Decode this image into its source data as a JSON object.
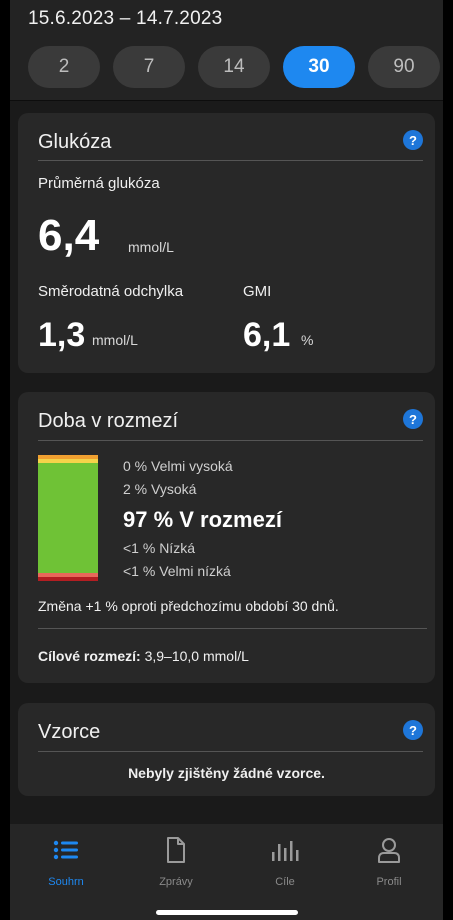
{
  "header": {
    "date_range": "15.6.2023 – 14.7.2023",
    "chips": [
      "2",
      "7",
      "14",
      "30",
      "90"
    ],
    "selected_chip": "30"
  },
  "glucose": {
    "title": "Glukóza",
    "help": "?",
    "avg_label": "Průměrná glukóza",
    "avg_value": "6,4",
    "avg_unit": "mmol/L",
    "sd_label": "Směrodatná odchylka",
    "sd_value": "1,3",
    "sd_unit": "mmol/L",
    "gmi_label": "GMI",
    "gmi_value": "6,1",
    "gmi_unit": "%"
  },
  "time_in_range": {
    "title": "Doba v rozmezí",
    "help": "?",
    "very_high": "0 % Velmi vysoká",
    "high": "2 % Vysoká",
    "in_range": "97 % V rozmezí",
    "low": "<1 % Nízká",
    "very_low": "<1 % Velmi nízká",
    "change_text": "Změna +1 % oproti předchozímu období 30 dnů.",
    "target_label": "Cílové rozmezí:",
    "target_value": "3,9–10,0 mmol/L",
    "segments": {
      "very_high": 0,
      "high": 2,
      "in_range": 97,
      "low": 0.5,
      "very_low": 0.5
    },
    "colors": {
      "very_high": "#f0a030",
      "high": "#f5d34a",
      "in_range": "#6fc236",
      "low": "#e8685a",
      "very_low": "#b31e22"
    }
  },
  "patterns": {
    "title": "Vzorce",
    "help": "?",
    "empty_text": "Nebyly zjištěny žádné vzorce."
  },
  "nav": {
    "items": [
      {
        "label": "Souhrn",
        "icon": "list-icon"
      },
      {
        "label": "Zprávy",
        "icon": "document-icon"
      },
      {
        "label": "Cíle",
        "icon": "bar-chart-icon"
      },
      {
        "label": "Profil",
        "icon": "person-icon"
      }
    ],
    "active": "Souhrn"
  },
  "colors": {
    "accent": "#1e88f0",
    "card": "#282828",
    "background": "#1a1a1a"
  }
}
